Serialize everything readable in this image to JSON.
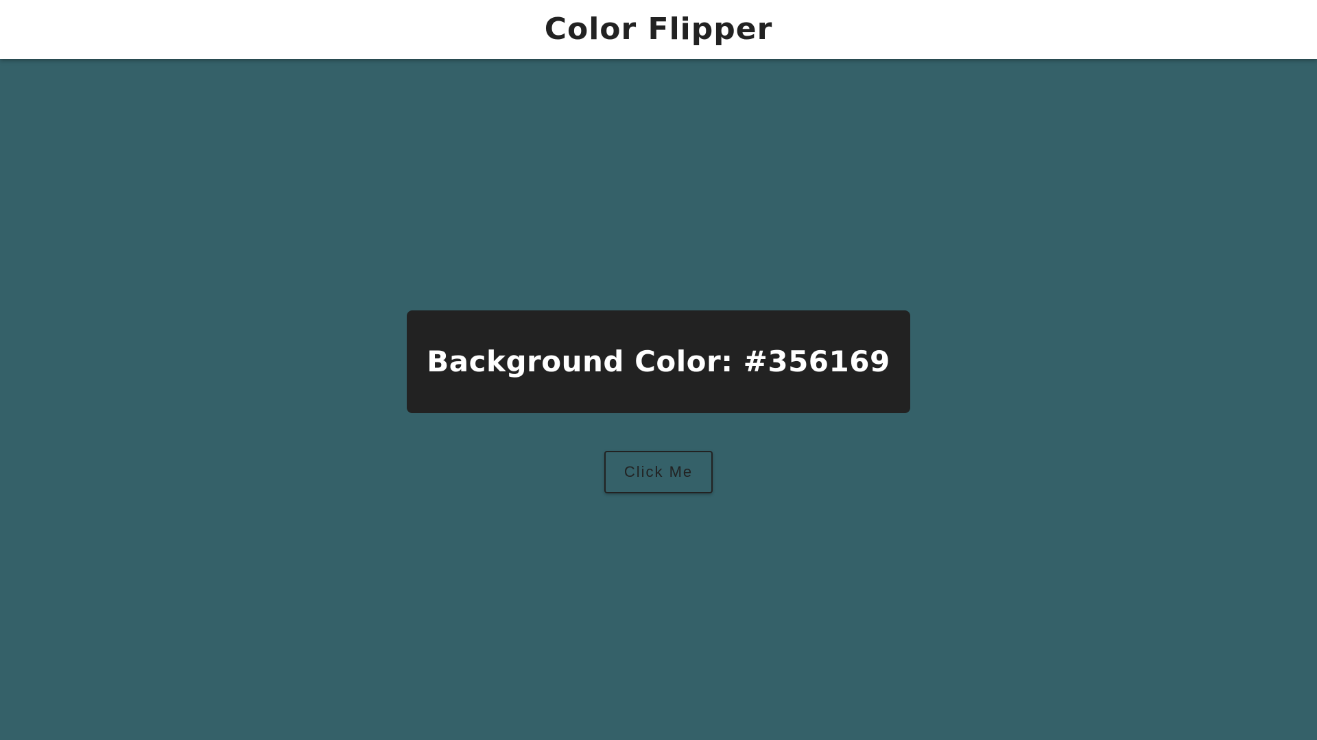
{
  "header": {
    "title": "Color Flipper"
  },
  "main": {
    "label": "Background Color: ",
    "color_value": "#356169",
    "button_label": "Click Me"
  },
  "colors": {
    "background": "#356169",
    "panel": "#222222",
    "header_bg": "#ffffff",
    "text_dark": "#222222",
    "text_light": "#ffffff"
  }
}
